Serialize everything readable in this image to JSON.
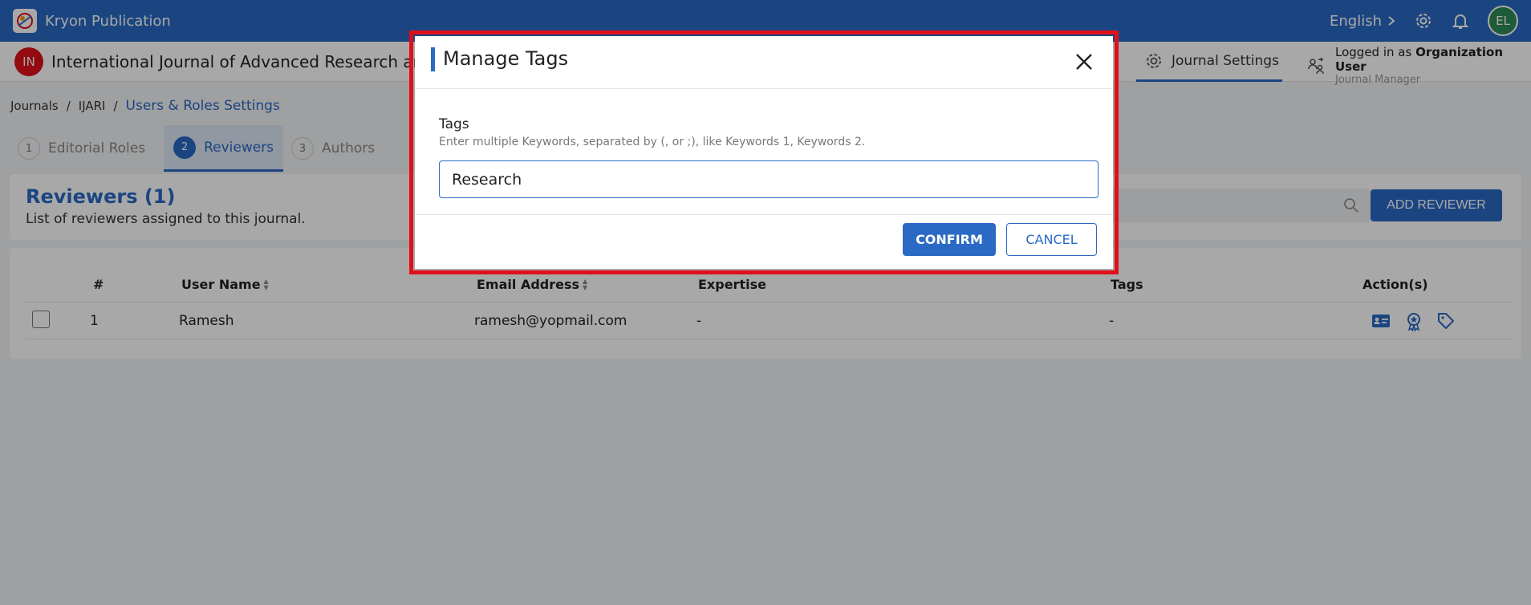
{
  "app": {
    "title": "Kryon Publication",
    "language": "English",
    "user_initials": "EL"
  },
  "journal": {
    "badge": "IN",
    "title": "International Journal of Advanced Research an",
    "settings_label": "Journal Settings",
    "logged_in_prefix": "Logged in as ",
    "logged_in_user": "Organization User",
    "logged_in_role": "Journal Manager"
  },
  "breadcrumb": {
    "items": [
      "Journals",
      "IJARI",
      "Users & Roles Settings"
    ],
    "separator": "/"
  },
  "tabs": [
    {
      "num": "1",
      "label": "Editorial Roles"
    },
    {
      "num": "2",
      "label": "Reviewers"
    },
    {
      "num": "3",
      "label": "Authors"
    }
  ],
  "reviewers": {
    "title": "Reviewers (1)",
    "subtitle": "List of reviewers assigned to this journal.",
    "add_button": "ADD REVIEWER"
  },
  "table": {
    "headers": [
      "#",
      "User Name",
      "Email Address",
      "Expertise",
      "Tags",
      "Action(s)"
    ],
    "rows": [
      {
        "num": "1",
        "user": "Ramesh",
        "email": "ramesh@yopmail.com",
        "expertise": "-",
        "tags": "-"
      }
    ]
  },
  "modal": {
    "title": "Manage Tags",
    "field_label": "Tags",
    "field_help": "Enter multiple Keywords, separated by (, or ;), like Keywords 1, Keywords 2.",
    "input_value": "Research",
    "confirm": "CONFIRM",
    "cancel": "CANCEL"
  },
  "colors": {
    "primary": "#2a6ac4",
    "highlight": "#e0101a",
    "avatar": "#2e8b57"
  },
  "icons": [
    "app-logo-icon",
    "chevron-right-icon",
    "gear-icon",
    "bell-icon",
    "journal-settings-icon",
    "user-switch-icon",
    "search-icon",
    "sort-icon",
    "id-card-icon",
    "award-icon",
    "tag-icon",
    "close-icon"
  ]
}
